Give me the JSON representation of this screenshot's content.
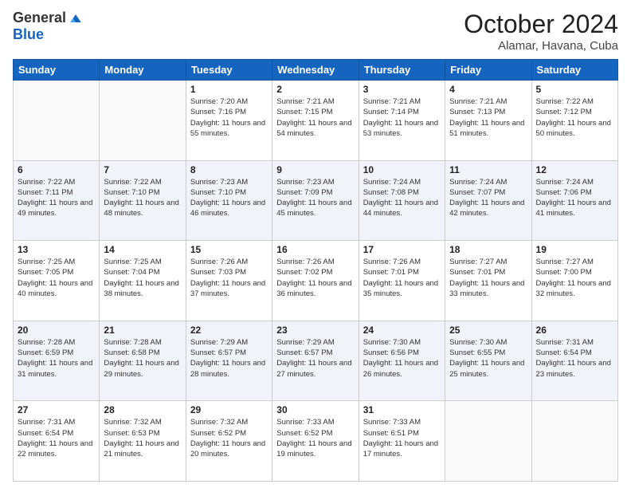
{
  "logo": {
    "general": "General",
    "blue": "Blue"
  },
  "title": "October 2024",
  "location": "Alamar, Havana, Cuba",
  "days_of_week": [
    "Sunday",
    "Monday",
    "Tuesday",
    "Wednesday",
    "Thursday",
    "Friday",
    "Saturday"
  ],
  "weeks": [
    [
      {
        "day": "",
        "info": ""
      },
      {
        "day": "",
        "info": ""
      },
      {
        "day": "1",
        "info": "Sunrise: 7:20 AM\nSunset: 7:16 PM\nDaylight: 11 hours and 55 minutes."
      },
      {
        "day": "2",
        "info": "Sunrise: 7:21 AM\nSunset: 7:15 PM\nDaylight: 11 hours and 54 minutes."
      },
      {
        "day": "3",
        "info": "Sunrise: 7:21 AM\nSunset: 7:14 PM\nDaylight: 11 hours and 53 minutes."
      },
      {
        "day": "4",
        "info": "Sunrise: 7:21 AM\nSunset: 7:13 PM\nDaylight: 11 hours and 51 minutes."
      },
      {
        "day": "5",
        "info": "Sunrise: 7:22 AM\nSunset: 7:12 PM\nDaylight: 11 hours and 50 minutes."
      }
    ],
    [
      {
        "day": "6",
        "info": "Sunrise: 7:22 AM\nSunset: 7:11 PM\nDaylight: 11 hours and 49 minutes."
      },
      {
        "day": "7",
        "info": "Sunrise: 7:22 AM\nSunset: 7:10 PM\nDaylight: 11 hours and 48 minutes."
      },
      {
        "day": "8",
        "info": "Sunrise: 7:23 AM\nSunset: 7:10 PM\nDaylight: 11 hours and 46 minutes."
      },
      {
        "day": "9",
        "info": "Sunrise: 7:23 AM\nSunset: 7:09 PM\nDaylight: 11 hours and 45 minutes."
      },
      {
        "day": "10",
        "info": "Sunrise: 7:24 AM\nSunset: 7:08 PM\nDaylight: 11 hours and 44 minutes."
      },
      {
        "day": "11",
        "info": "Sunrise: 7:24 AM\nSunset: 7:07 PM\nDaylight: 11 hours and 42 minutes."
      },
      {
        "day": "12",
        "info": "Sunrise: 7:24 AM\nSunset: 7:06 PM\nDaylight: 11 hours and 41 minutes."
      }
    ],
    [
      {
        "day": "13",
        "info": "Sunrise: 7:25 AM\nSunset: 7:05 PM\nDaylight: 11 hours and 40 minutes."
      },
      {
        "day": "14",
        "info": "Sunrise: 7:25 AM\nSunset: 7:04 PM\nDaylight: 11 hours and 38 minutes."
      },
      {
        "day": "15",
        "info": "Sunrise: 7:26 AM\nSunset: 7:03 PM\nDaylight: 11 hours and 37 minutes."
      },
      {
        "day": "16",
        "info": "Sunrise: 7:26 AM\nSunset: 7:02 PM\nDaylight: 11 hours and 36 minutes."
      },
      {
        "day": "17",
        "info": "Sunrise: 7:26 AM\nSunset: 7:01 PM\nDaylight: 11 hours and 35 minutes."
      },
      {
        "day": "18",
        "info": "Sunrise: 7:27 AM\nSunset: 7:01 PM\nDaylight: 11 hours and 33 minutes."
      },
      {
        "day": "19",
        "info": "Sunrise: 7:27 AM\nSunset: 7:00 PM\nDaylight: 11 hours and 32 minutes."
      }
    ],
    [
      {
        "day": "20",
        "info": "Sunrise: 7:28 AM\nSunset: 6:59 PM\nDaylight: 11 hours and 31 minutes."
      },
      {
        "day": "21",
        "info": "Sunrise: 7:28 AM\nSunset: 6:58 PM\nDaylight: 11 hours and 29 minutes."
      },
      {
        "day": "22",
        "info": "Sunrise: 7:29 AM\nSunset: 6:57 PM\nDaylight: 11 hours and 28 minutes."
      },
      {
        "day": "23",
        "info": "Sunrise: 7:29 AM\nSunset: 6:57 PM\nDaylight: 11 hours and 27 minutes."
      },
      {
        "day": "24",
        "info": "Sunrise: 7:30 AM\nSunset: 6:56 PM\nDaylight: 11 hours and 26 minutes."
      },
      {
        "day": "25",
        "info": "Sunrise: 7:30 AM\nSunset: 6:55 PM\nDaylight: 11 hours and 25 minutes."
      },
      {
        "day": "26",
        "info": "Sunrise: 7:31 AM\nSunset: 6:54 PM\nDaylight: 11 hours and 23 minutes."
      }
    ],
    [
      {
        "day": "27",
        "info": "Sunrise: 7:31 AM\nSunset: 6:54 PM\nDaylight: 11 hours and 22 minutes."
      },
      {
        "day": "28",
        "info": "Sunrise: 7:32 AM\nSunset: 6:53 PM\nDaylight: 11 hours and 21 minutes."
      },
      {
        "day": "29",
        "info": "Sunrise: 7:32 AM\nSunset: 6:52 PM\nDaylight: 11 hours and 20 minutes."
      },
      {
        "day": "30",
        "info": "Sunrise: 7:33 AM\nSunset: 6:52 PM\nDaylight: 11 hours and 19 minutes."
      },
      {
        "day": "31",
        "info": "Sunrise: 7:33 AM\nSunset: 6:51 PM\nDaylight: 11 hours and 17 minutes."
      },
      {
        "day": "",
        "info": ""
      },
      {
        "day": "",
        "info": ""
      }
    ]
  ]
}
